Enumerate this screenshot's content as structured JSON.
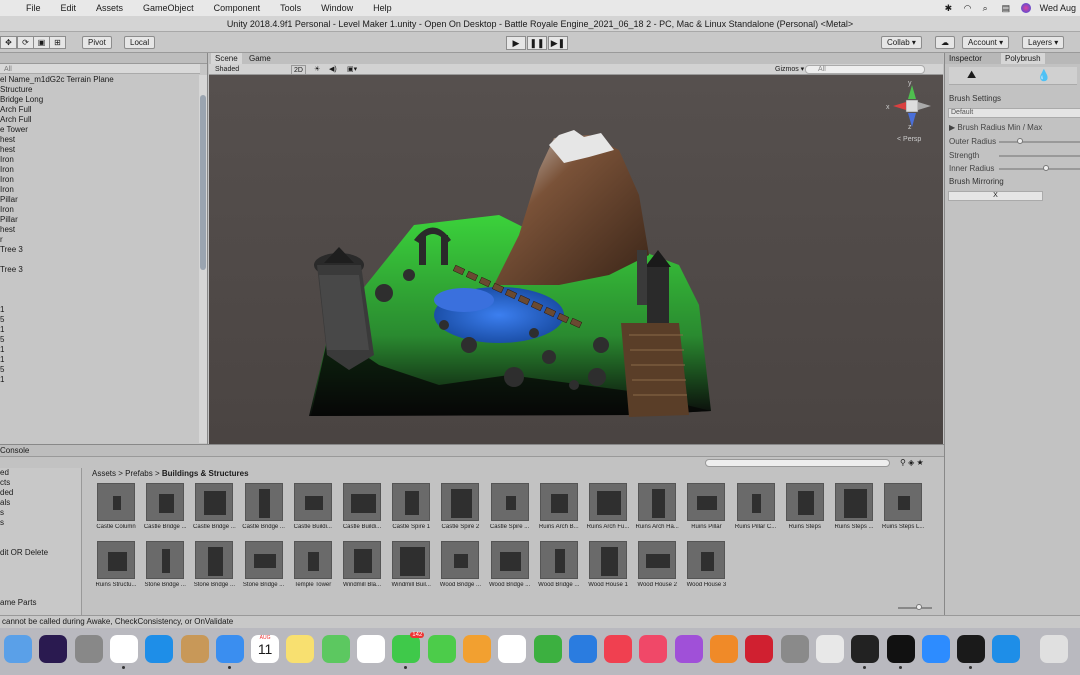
{
  "menubar": {
    "items": [
      "File",
      "Edit",
      "Assets",
      "GameObject",
      "Component",
      "Tools",
      "Window",
      "Help"
    ],
    "clock": "Wed Aug"
  },
  "window": {
    "title": "Unity 2018.4.9f1 Personal - Level Maker 1.unity - Open On Desktop - Battle Royale Engine_2021_06_18 2 - PC, Mac & Linux Standalone (Personal) <Metal>"
  },
  "toolbar": {
    "pivot": "Pivot",
    "local": "Local",
    "collab": "Collab ▾",
    "account": "Account ▾",
    "layers": "Layers ▾"
  },
  "hierarchy": {
    "search_placeholder": "All",
    "rows": [
      "el Name_m1dG2c Terrain Plane",
      "Structure",
      "Bridge Long",
      "Arch Full",
      "Arch Full",
      "e Tower",
      "hest",
      "hest",
      "Iron",
      "Iron",
      "Iron",
      "Iron",
      "Pillar",
      "Iron",
      "Pillar",
      "hest",
      "r",
      "Tree 3",
      "",
      "Tree 3",
      "",
      "",
      "",
      "1",
      "5",
      "1",
      "5",
      "1",
      "1",
      "5",
      "1",
      "",
      "",
      ""
    ]
  },
  "scene": {
    "tab_scene": "Scene",
    "tab_game": "Game",
    "shading": "Shaded",
    "mode_2d": "2D",
    "gizmos": "Gizmos ▾",
    "search_placeholder": "All",
    "persp": "< Persp",
    "axis_y": "y",
    "axis_x": "x",
    "axis_z": "z"
  },
  "inspector": {
    "tab_inspector": "Inspector",
    "tab_polybrush": "Polybrush",
    "brush_settings": "Brush Settings",
    "preset": "Default",
    "radius_minmax": "Brush Radius Min / Max",
    "outer_radius": "Outer Radius",
    "strength": "Strength",
    "inner_radius": "Inner Radius",
    "mirroring": "Brush Mirroring",
    "mirror_axis": "X"
  },
  "console": {
    "tab": "Console"
  },
  "project": {
    "left_rows": [
      "ed",
      "cts",
      "ded",
      "als",
      "s",
      "s",
      "",
      "",
      "dit OR Delete",
      "",
      "",
      "",
      "",
      "ame Parts"
    ],
    "breadcrumb": [
      "Assets",
      "Prefabs",
      "Buildings & Structures"
    ],
    "assets": [
      "Castle Column",
      "Castle Bridge ...",
      "Castle Bridge ...",
      "Castle Bridge ...",
      "Castle Buildi...",
      "Castle Buildi...",
      "Castle Spire 1",
      "Castle Spire 2",
      "Castle Spire ...",
      "Ruins Arch B...",
      "Ruins Arch Fu...",
      "Ruins Arch Ha...",
      "Ruins Pillar",
      "Ruins Pillar C...",
      "Ruins Steps",
      "Ruins Steps ...",
      "Ruins Steps L...",
      "Ruins Structu...",
      "Stone Bridge ...",
      "Stone Bridge ...",
      "Stone Bridge ...",
      "Temple Tower",
      "Windmill Bla...",
      "Windmill Buil...",
      "Wood Bridge ...",
      "Wood Bridge ...",
      "Wood Bridge ...",
      "Wood House 1",
      "Wood House 2",
      "Wood House 3"
    ]
  },
  "status": {
    "message": "cannot be called during Awake, CheckConsistency, or OnValidate"
  },
  "dock": {
    "calendar_month": "AUG",
    "calendar_day": "11",
    "messages_badge": "142",
    "apps": [
      "finder",
      "siri",
      "launchpad",
      "chrome",
      "safari",
      "contacts",
      "mail",
      "calendar",
      "notes",
      "maps",
      "photos",
      "messages",
      "facetime",
      "pages",
      "reminders",
      "numbers",
      "keynote",
      "news",
      "music",
      "podcasts",
      "books",
      "photo-booth",
      "system-preferences",
      "roblox",
      "unity-hub",
      "unity",
      "zoom",
      "terminal",
      "safari-2",
      "trash"
    ]
  }
}
